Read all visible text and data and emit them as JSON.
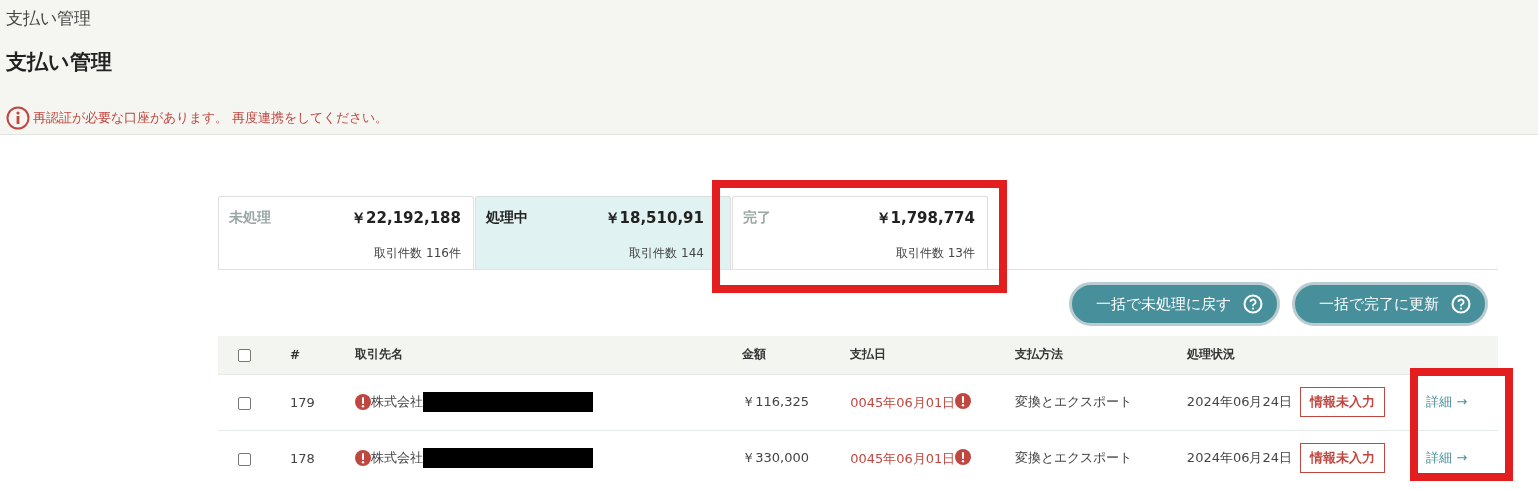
{
  "breadcrumb": "支払い管理",
  "title": "支払い管理",
  "alert": "再認証が必要な口座があります。 再度連携をしてください。",
  "tabs": [
    {
      "label": "未処理",
      "amount": "￥22,192,188",
      "count": "取引件数 116件",
      "selected": false
    },
    {
      "label": "処理中",
      "amount": "￥18,510,91",
      "count": "取引件数 144",
      "selected": true
    },
    {
      "label": "完了",
      "amount": "￥1,798,774",
      "count": "取引件数 13件",
      "selected": false
    }
  ],
  "actions": [
    {
      "label": "一括で未処理に戻す"
    },
    {
      "label": "一括で完了に更新"
    }
  ],
  "table": {
    "columns": [
      "#",
      "取引先名",
      "金額",
      "支払日",
      "支払方法",
      "処理状況"
    ],
    "header_checked": false,
    "rows": [
      {
        "checked": false,
        "number": "179",
        "vendor": "株式会社",
        "vendor_warning": true,
        "amount": "￥116,325",
        "pay_date": "0045年06月01日",
        "date_warning": true,
        "method": "変換とエクスポート",
        "status_date": "2024年06月24日",
        "status": "情報未入力",
        "detail": "詳細 →"
      },
      {
        "checked": false,
        "number": "178",
        "vendor": "株式会社",
        "vendor_warning": true,
        "amount": "￥330,000",
        "pay_date": "0045年06月01日",
        "date_warning": true,
        "method": "変換とエクスポート",
        "status_date": "2024年06月24日",
        "status": "情報未入力",
        "detail": "詳細 →"
      }
    ]
  }
}
